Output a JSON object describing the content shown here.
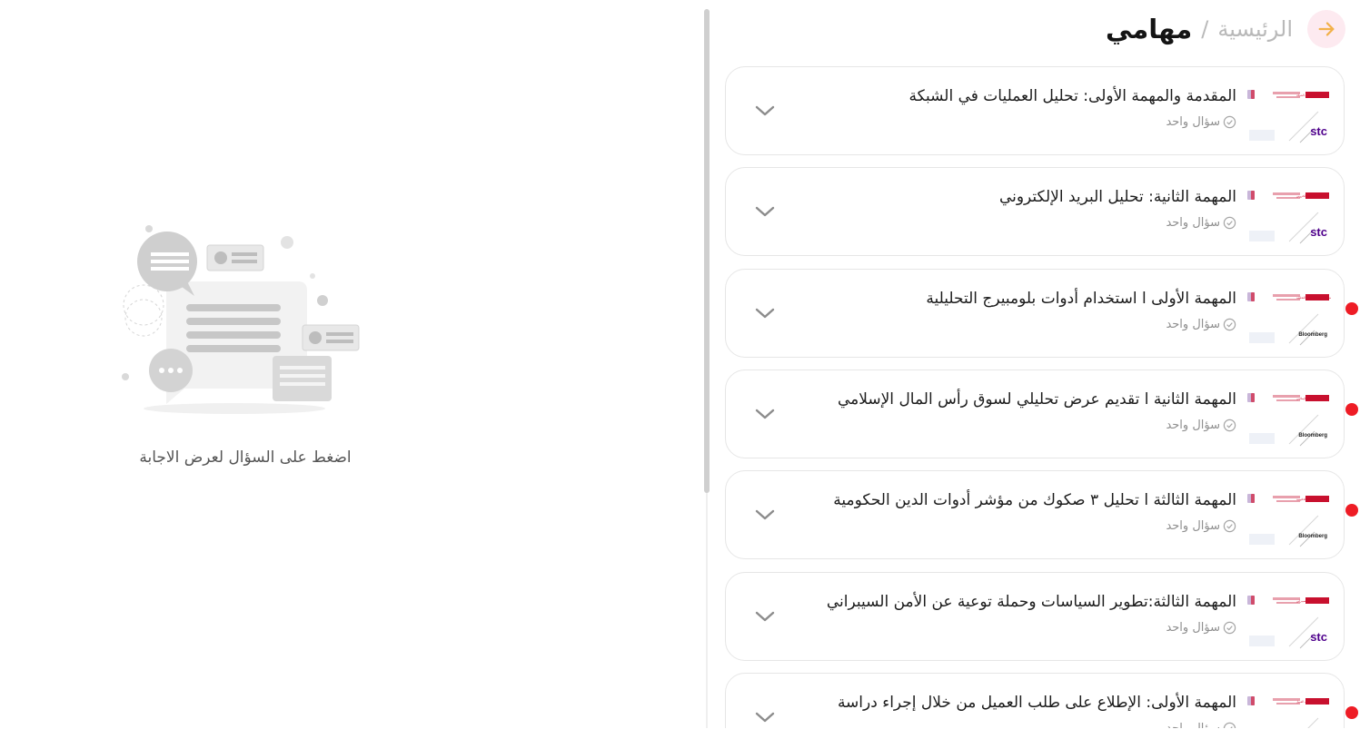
{
  "header": {
    "home_label": "الرئيسية",
    "separator": "/",
    "current_label": "مهامي",
    "back_icon": "arrow-right-icon",
    "accent_color": "#f2b14a"
  },
  "tasks": [
    {
      "title": "المقدمة والمهمة الأولى: تحليل العمليات في الشبكة",
      "subtitle": "سؤال واحد",
      "thumb_brand": "stc",
      "thumb_caption": "تحليل العمليات في الشبكة",
      "unread": false
    },
    {
      "title": "المهمة الثانية: تحليل البريد الإلكتروني",
      "subtitle": "سؤال واحد",
      "thumb_brand": "stc",
      "thumb_caption": "تحليل البريد الإلكتروني",
      "unread": false
    },
    {
      "title": "المهمة الأولى ا استخدام أدوات بلومبيرج التحليلية",
      "subtitle": "سؤال واحد",
      "thumb_brand": "Bloomberg",
      "thumb_caption": "استخدام أدوات بلومبيرج التحليلية",
      "unread": true
    },
    {
      "title": "المهمة الثانية ا تقديم عرض تحليلي لسوق رأس المال الإسلامي",
      "subtitle": "سؤال واحد",
      "thumb_brand": "Bloomberg",
      "thumb_caption": "سوق رأس المال الإسلامي",
      "unread": true
    },
    {
      "title": "المهمة الثالثة ا تحليل ٣ صكوك من مؤشر أدوات الدين الحكومية",
      "subtitle": "سؤال واحد",
      "thumb_brand": "Bloomberg",
      "thumb_caption": "أدوات الدين الحكومية",
      "unread": true
    },
    {
      "title": "المهمة الثالثة:تطوير السياسات وحملة توعية عن الأمن السيبراني",
      "subtitle": "سؤال واحد",
      "thumb_brand": "stc",
      "thumb_caption": "الأمن السيبراني",
      "unread": false
    },
    {
      "title": "المهمة الأولى: الإطلاع على طلب العميل من خلال إجراء دراسة",
      "subtitle": "سؤال واحد",
      "thumb_brand": "",
      "thumb_caption": "طلب العميل",
      "unread": true
    }
  ],
  "empty_state": {
    "message": "اضغط على السؤال لعرض الاجابة",
    "illustration_icon": "chat-messages-illustration-icon"
  },
  "colors": {
    "unread_dot": "#ee1c25",
    "thumb_red": "#c8102e",
    "stc_purple": "#4f008c"
  }
}
